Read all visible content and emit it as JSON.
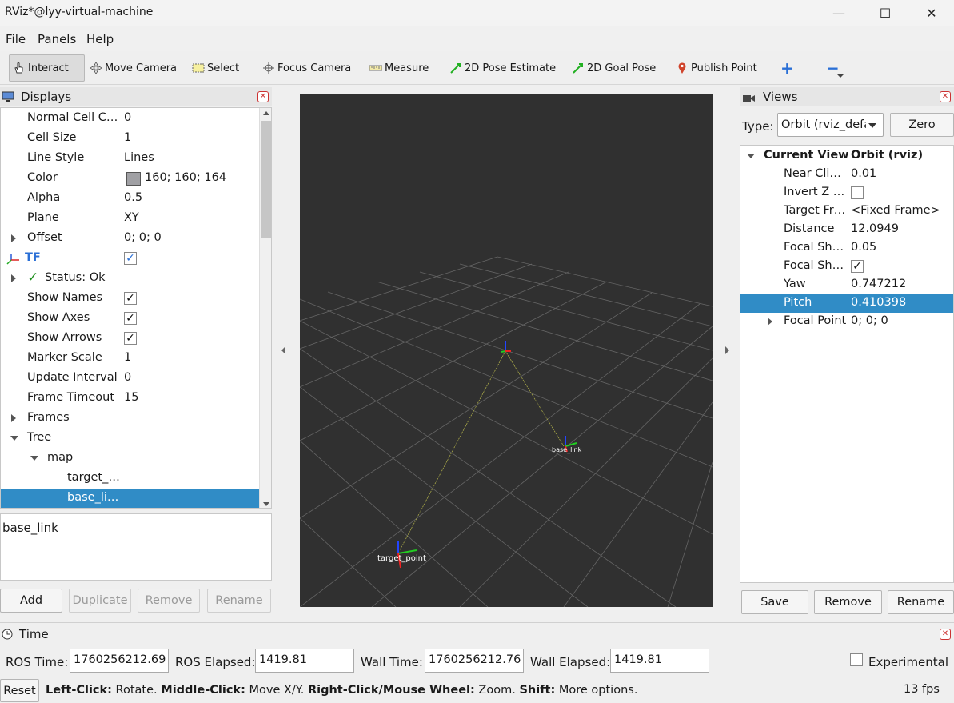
{
  "window": {
    "title": "RViz*@lyy-virtual-machine",
    "minimize": "—",
    "maximize": "☐",
    "close": "✕"
  },
  "menu": {
    "file": "File",
    "panels": "Panels",
    "help": "Help"
  },
  "toolbar": {
    "interact": "Interact",
    "move_camera": "Move Camera",
    "select": "Select",
    "focus_camera": "Focus Camera",
    "measure": "Measure",
    "pose_estimate": "2D Pose Estimate",
    "goal_pose": "2D Goal Pose",
    "publish_point": "Publish Point",
    "plus": "+",
    "minus": "−"
  },
  "displays": {
    "title": "Displays",
    "rows": [
      {
        "key": "Normal Cell C…",
        "value": "0"
      },
      {
        "key": "Cell Size",
        "value": "1"
      },
      {
        "key": "Line Style",
        "value": "Lines"
      },
      {
        "key": "Color",
        "value": "160; 160; 164"
      },
      {
        "key": "Alpha",
        "value": "0.5"
      },
      {
        "key": "Plane",
        "value": "XY"
      },
      {
        "key": "Offset",
        "value": "0; 0; 0"
      },
      {
        "key": "TF",
        "value": ""
      },
      {
        "key": "Status: Ok",
        "value": ""
      },
      {
        "key": "Show Names",
        "value": ""
      },
      {
        "key": "Show Axes",
        "value": ""
      },
      {
        "key": "Show Arrows",
        "value": ""
      },
      {
        "key": "Marker Scale",
        "value": "1"
      },
      {
        "key": "Update Interval",
        "value": "0"
      },
      {
        "key": "Frame Timeout",
        "value": "15"
      },
      {
        "key": "Frames",
        "value": ""
      },
      {
        "key": "Tree",
        "value": ""
      },
      {
        "key": "map",
        "value": ""
      },
      {
        "key": "target_…",
        "value": ""
      },
      {
        "key": "base_li…",
        "value": ""
      }
    ],
    "color_swatch": "#a0a0a4",
    "description": "base_link",
    "buttons": {
      "add": "Add",
      "duplicate": "Duplicate",
      "remove": "Remove",
      "rename": "Rename"
    }
  },
  "viewport": {
    "frame_labels": {
      "target": "target_point",
      "base": "base_link"
    },
    "background": "#303030"
  },
  "views": {
    "title": "Views",
    "type_label": "Type:",
    "type_value": "Orbit (rviz_defa",
    "zero": "Zero",
    "rows": [
      {
        "key": "Current View",
        "value": "Orbit (rviz)"
      },
      {
        "key": "Near Cli…",
        "value": "0.01"
      },
      {
        "key": "Invert Z …",
        "value": ""
      },
      {
        "key": "Target Fr…",
        "value": "<Fixed Frame>"
      },
      {
        "key": "Distance",
        "value": "12.0949"
      },
      {
        "key": "Focal Sh…",
        "value": "0.05"
      },
      {
        "key": "Focal Sh…",
        "value": ""
      },
      {
        "key": "Yaw",
        "value": "0.747212"
      },
      {
        "key": "Pitch",
        "value": "0.410398"
      },
      {
        "key": "Focal Point",
        "value": "0; 0; 0"
      }
    ],
    "buttons": {
      "save": "Save",
      "remove": "Remove",
      "rename": "Rename"
    }
  },
  "time": {
    "title": "Time",
    "ros_time_label": "ROS Time:",
    "ros_time": "1760256212.69",
    "ros_elapsed_label": "ROS Elapsed:",
    "ros_elapsed": "1419.81",
    "wall_time_label": "Wall Time:",
    "wall_time": "1760256212.76",
    "wall_elapsed_label": "Wall Elapsed:",
    "wall_elapsed": "1419.81",
    "experimental": "Experimental"
  },
  "status": {
    "reset": "Reset",
    "left_click": "Left-Click:",
    "rotate": " Rotate. ",
    "middle_click": "Middle-Click:",
    "move": " Move X/Y. ",
    "right_click": "Right-Click/Mouse Wheel:",
    "zoom": " Zoom. ",
    "shift": "Shift:",
    "more": " More options.",
    "fps": "13 fps"
  }
}
